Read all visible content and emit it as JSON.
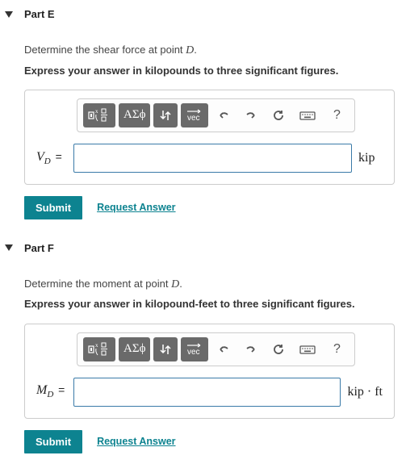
{
  "parts": [
    {
      "id": "E",
      "title": "Part E",
      "prompt_prefix": "Determine the shear force at point ",
      "prompt_point": "D",
      "prompt_suffix": ".",
      "express": "Express your answer in kilopounds to three significant figures.",
      "variable_main": "V",
      "variable_sub": "D",
      "unit": "kip",
      "submit": "Submit",
      "request": "Request Answer"
    },
    {
      "id": "F",
      "title": "Part F",
      "prompt_prefix": "Determine the moment at point ",
      "prompt_point": "D",
      "prompt_suffix": ".",
      "express": "Express your answer in kilopound-feet to three significant figures.",
      "variable_main": "M",
      "variable_sub": "D",
      "unit": "kip · ft",
      "submit": "Submit",
      "request": "Request Answer"
    }
  ],
  "toolbar": {
    "templates": "templates",
    "greek": "ΑΣϕ",
    "updown": "↓↑",
    "vec": "vec",
    "undo": "undo",
    "redo": "redo",
    "reset": "reset",
    "keyboard": "keyboard",
    "help": "?"
  }
}
